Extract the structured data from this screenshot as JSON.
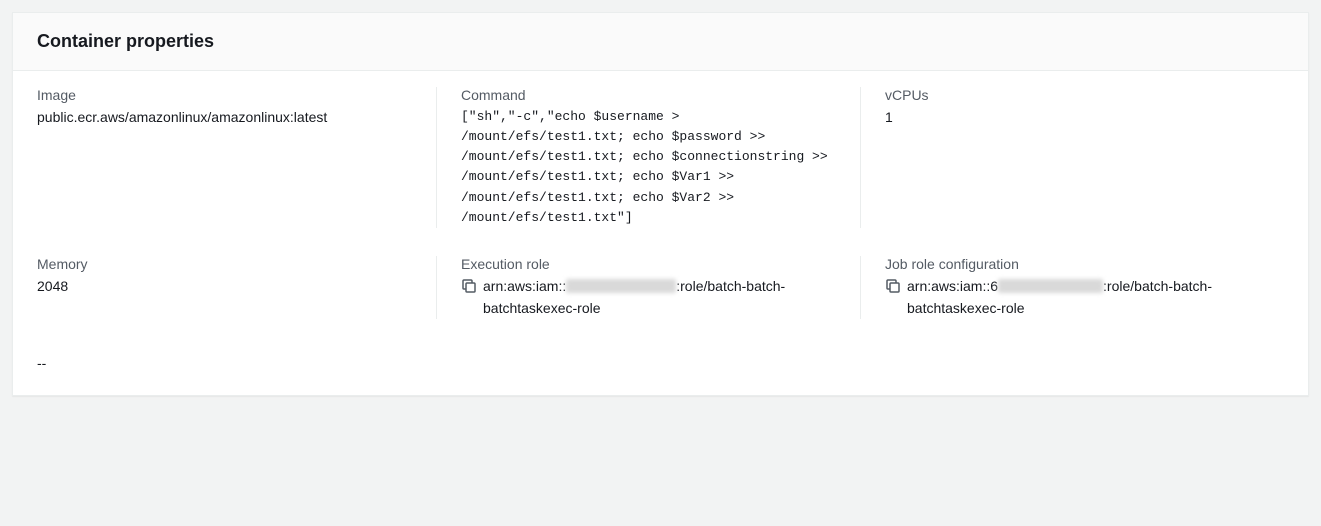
{
  "panel": {
    "title": "Container properties"
  },
  "fields": {
    "image": {
      "label": "Image",
      "value": "public.ecr.aws/amazonlinux/amazonlinux:latest"
    },
    "command": {
      "label": "Command",
      "value": "[\"sh\",\"-c\",\"echo $username > /mount/efs/test1.txt; echo $password >> /mount/efs/test1.txt; echo $connectionstring >> /mount/efs/test1.txt; echo $Var1 >> /mount/efs/test1.txt; echo $Var2 >> /mount/efs/test1.txt\"]"
    },
    "vcpus": {
      "label": "vCPUs",
      "value": "1"
    },
    "memory": {
      "label": "Memory",
      "value": "2048"
    },
    "execution_role": {
      "label": "Execution role",
      "prefix": "arn:aws:iam::",
      "suffix": ":role/batch-batch-batchtaskexec-role"
    },
    "job_role": {
      "label": "Job role configuration",
      "prefix": "arn:aws:iam::6",
      "suffix": ":role/batch-batch-batchtaskexec-role"
    },
    "extra": {
      "value": "--"
    }
  }
}
